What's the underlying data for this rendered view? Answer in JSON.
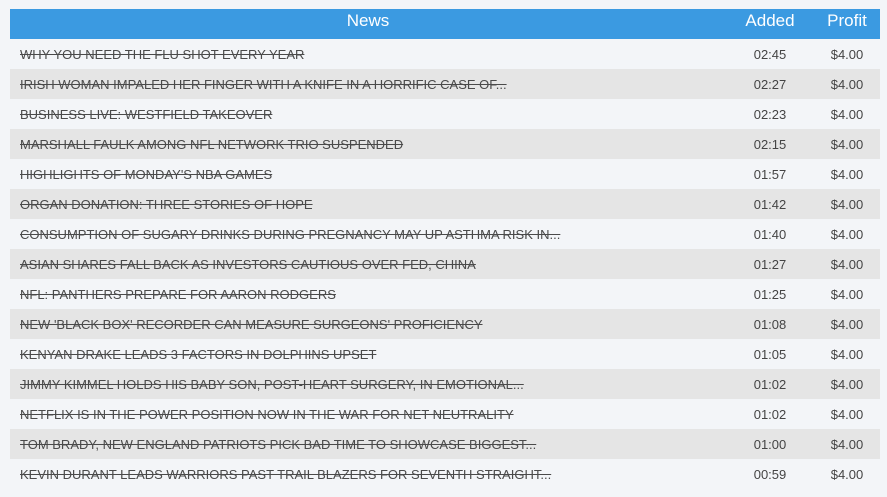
{
  "table": {
    "headers": {
      "news": "News",
      "added": "Added",
      "profit": "Profit"
    },
    "rows": [
      {
        "news": "WHY YOU NEED THE FLU SHOT EVERY YEAR",
        "added": "02:45",
        "profit": "$4.00"
      },
      {
        "news": "IRISH WOMAN IMPALED HER FINGER WITH A KNIFE IN A HORRIFIC CASE OF...",
        "added": "02:27",
        "profit": "$4.00"
      },
      {
        "news": "BUSINESS LIVE: WESTFIELD TAKEOVER",
        "added": "02:23",
        "profit": "$4.00"
      },
      {
        "news": "MARSHALL FAULK AMONG NFL NETWORK TRIO SUSPENDED",
        "added": "02:15",
        "profit": "$4.00"
      },
      {
        "news": "HIGHLIGHTS OF MONDAY'S NBA GAMES",
        "added": "01:57",
        "profit": "$4.00"
      },
      {
        "news": "ORGAN DONATION: THREE STORIES OF HOPE",
        "added": "01:42",
        "profit": "$4.00"
      },
      {
        "news": "CONSUMPTION OF SUGARY DRINKS DURING PREGNANCY MAY UP ASTHMA RISK IN...",
        "added": "01:40",
        "profit": "$4.00"
      },
      {
        "news": "ASIAN SHARES FALL BACK AS INVESTORS CAUTIOUS OVER FED, CHINA",
        "added": "01:27",
        "profit": "$4.00"
      },
      {
        "news": "NFL: PANTHERS PREPARE FOR AARON RODGERS",
        "added": "01:25",
        "profit": "$4.00"
      },
      {
        "news": "NEW 'BLACK BOX' RECORDER CAN MEASURE SURGEONS' PROFICIENCY",
        "added": "01:08",
        "profit": "$4.00"
      },
      {
        "news": "KENYAN DRAKE LEADS 3 FACTORS IN DOLPHINS UPSET",
        "added": "01:05",
        "profit": "$4.00"
      },
      {
        "news": "JIMMY KIMMEL HOLDS HIS BABY SON, POST-HEART SURGERY, IN EMOTIONAL...",
        "added": "01:02",
        "profit": "$4.00"
      },
      {
        "news": "NETFLIX IS IN THE POWER POSITION NOW IN THE WAR FOR NET NEUTRALITY",
        "added": "01:02",
        "profit": "$4.00"
      },
      {
        "news": "TOM BRADY, NEW ENGLAND PATRIOTS PICK BAD TIME TO SHOWCASE BIGGEST...",
        "added": "01:00",
        "profit": "$4.00"
      },
      {
        "news": "KEVIN DURANT LEADS WARRIORS PAST TRAIL BLAZERS FOR SEVENTH STRAIGHT...",
        "added": "00:59",
        "profit": "$4.00"
      }
    ]
  },
  "colors": {
    "header_bg": "#3b9ae1",
    "row_odd": "#f3f5f8",
    "row_even": "#e5e5e5"
  }
}
